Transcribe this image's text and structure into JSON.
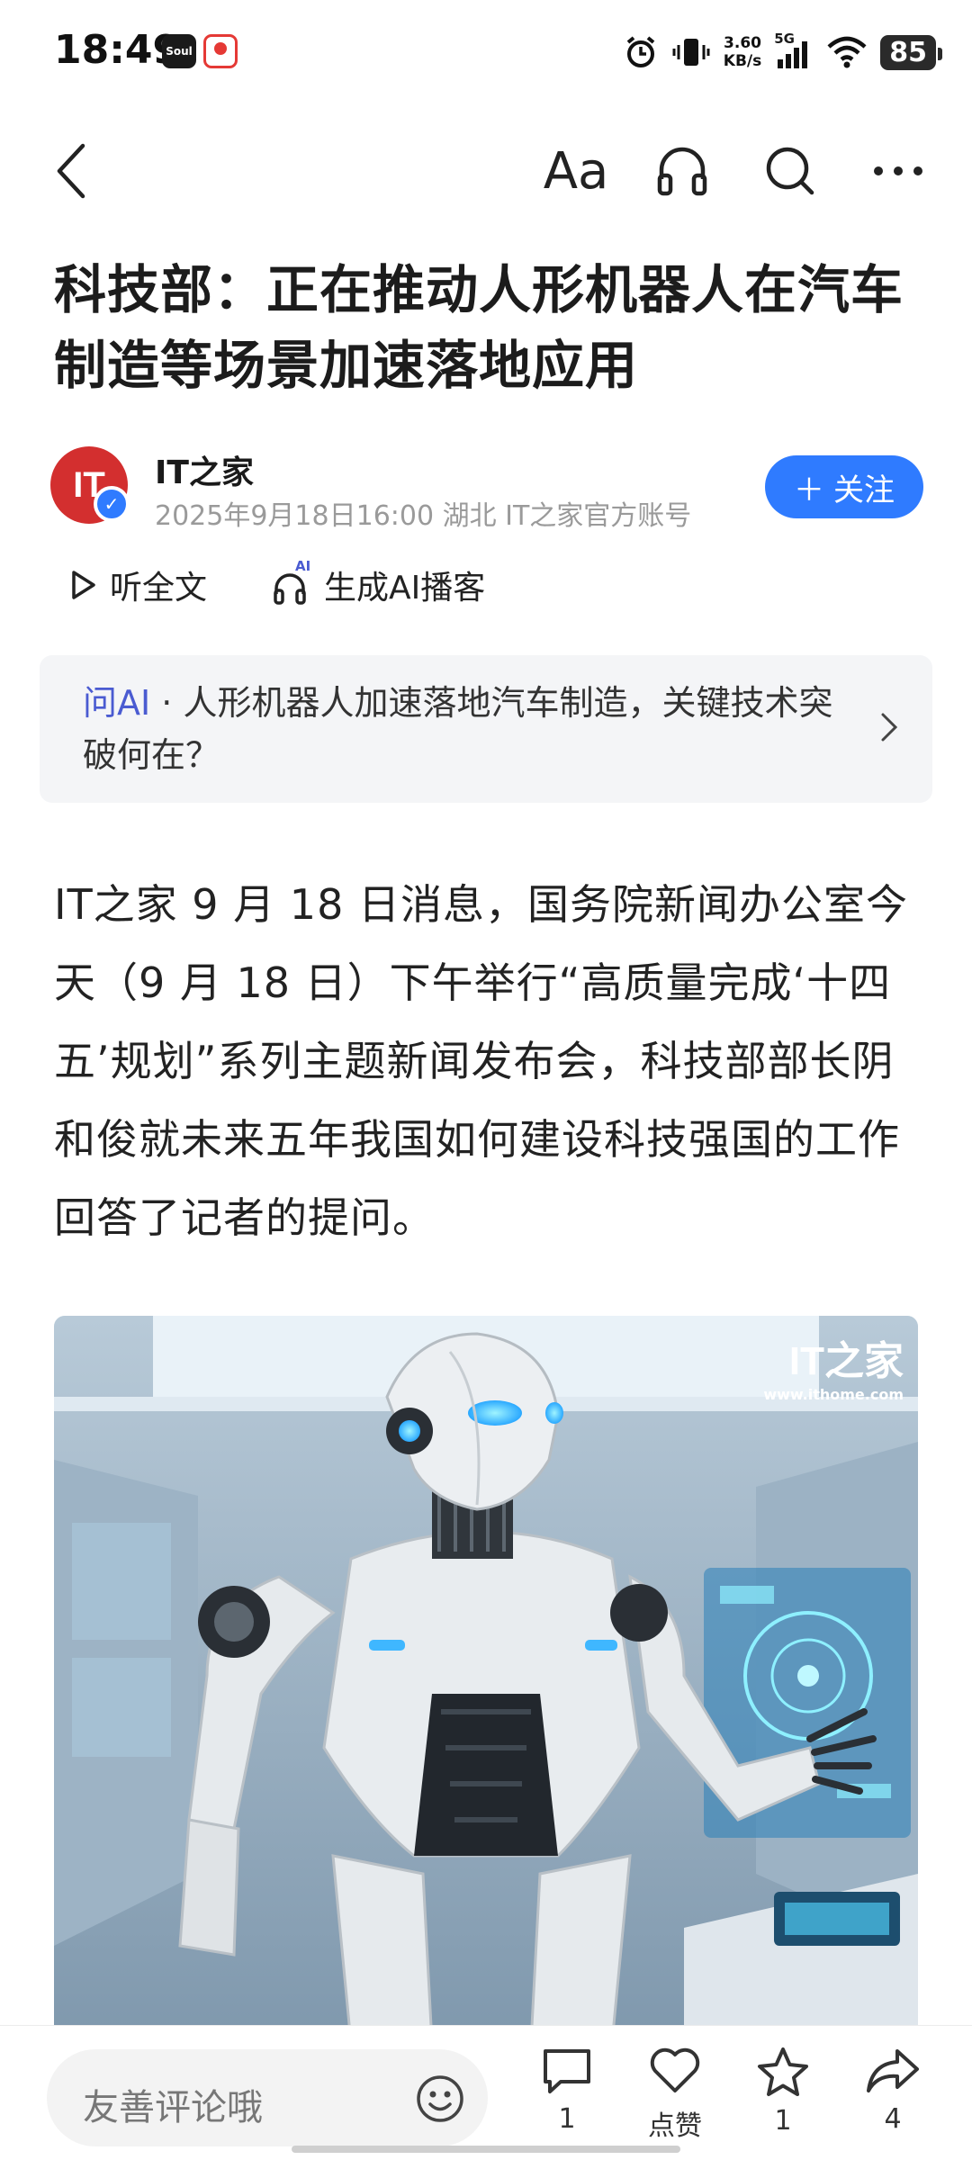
{
  "status_bar": {
    "time": "18:49",
    "apps": [
      "Soul",
      "news-app"
    ],
    "net_speed_value": "3.60",
    "net_speed_unit": "KB/s",
    "network": "5G",
    "battery": "85",
    "icons": [
      "alarm-icon",
      "vibrate-icon",
      "signal-icon",
      "wifi-icon",
      "battery-icon"
    ]
  },
  "nav": {
    "font_label": "Aa",
    "icons": [
      "back-icon",
      "font-size-icon",
      "headphones-icon",
      "search-icon",
      "more-icon"
    ]
  },
  "article": {
    "title": "科技部：正在推动人形机器人在汽车制造等场景加速落地应用",
    "author": {
      "name": "IT之家",
      "avatar_text": "IT",
      "meta": "2025年9月18日16:00 湖北 IT之家官方账号",
      "follow_label": "关注"
    },
    "actions": {
      "listen_label": "听全文",
      "podcast_label": "生成AI播客",
      "ai_badge": "AI"
    },
    "ask_ai": {
      "label": "问AI",
      "separator": "·",
      "question": "人形机器人加速落地汽车制造，关键技术突破何在？"
    },
    "body": "IT之家 9 月 18 日消息，国务院新闻办公室今天（9 月 18 日）下午举行“高质量完成‘十四五’规划”系列主题新闻发布会，科技部部长阴和俊就未来五年我国如何建设科技强国的工作回答了记者的提问。",
    "image": {
      "watermark_logo": "IT之家",
      "watermark_url": "www.ithome.com"
    }
  },
  "bottom_bar": {
    "comment_placeholder": "友善评论哦",
    "comments_count": "1",
    "like_label": "点赞",
    "favorites_count": "1",
    "shares_count": "4"
  },
  "colors": {
    "accent": "#2f7bff",
    "brand_red": "#d32f2f",
    "ask_ai_label": "#4a5bd1",
    "card_bg": "#f4f5f7"
  }
}
